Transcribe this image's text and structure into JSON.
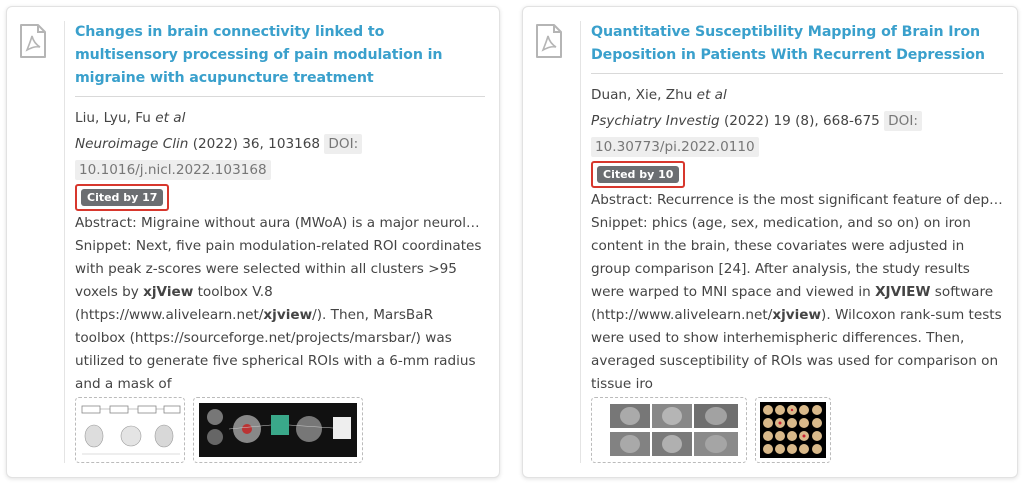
{
  "articles": [
    {
      "title": "Changes in brain connectivity linked to multisensory processing of pain modulation in migraine with acupuncture treatment",
      "authors": "Liu, Lyu, Fu",
      "et_al": "et al",
      "journal": "Neuroimage Clin",
      "citation": "(2022) 36, 103168",
      "doi_label": "DOI:",
      "doi": "10.1016/j.nicl.2022.103168",
      "cited_by": "Cited by 17",
      "abstract": "Abstract: Migraine without aura (MWoA) is a major neurolo…",
      "snippet_pre": "Snippet: Next, five pain modulation-related ROI coordinates with peak z-scores were selected within all clusters >95 voxels by ",
      "snippet_b1": "xjView",
      "snippet_mid": " toolbox V.8 (https://www.alivelearn.net/",
      "snippet_b2": "xjview",
      "snippet_post": "/). Then, MarsBaR toolbox (https://sourceforge.net/projects/marsbar/) was utilized to generate five spherical ROIs with a 6-mm radius and a mask of",
      "thumbnails": [
        "flowchart-figure",
        "brain-connectivity-figure"
      ]
    },
    {
      "title": "Quantitative Susceptibility Mapping of Brain Iron Deposition in Patients With Recurrent Depression",
      "authors": "Duan, Xie, Zhu",
      "et_al": "et al",
      "journal": "Psychiatry Investig",
      "citation": "(2022) 19 (8), 668-675",
      "doi_label": "DOI:",
      "doi": "10.30773/pi.2022.0110",
      "cited_by": "Cited by 10",
      "abstract": "Abstract: Recurrence is the most significant feature of depr…",
      "snippet_pre": "Snippet: phics (age, sex, medication, and so on) on iron content in the brain, these covariates were adjusted in group comparison [24]. After analysis, the study results were warped to MNI space and viewed in ",
      "snippet_b1": "XJVIEW",
      "snippet_mid": " software (http://www.alivelearn.net/",
      "snippet_b2": "xjview",
      "snippet_post": "). Wilcoxon rank-sum tests were used to show interhemispheric differences. Then, averaged susceptibility of ROIs was used for comparison on tissue iro",
      "thumbnails": [
        "mri-slices-figure",
        "brain-slices-grid-figure"
      ]
    }
  ],
  "colors": {
    "title": "#3aa0cc",
    "badge_bg": "#6b6e72",
    "highlight_border": "#d7372d"
  }
}
